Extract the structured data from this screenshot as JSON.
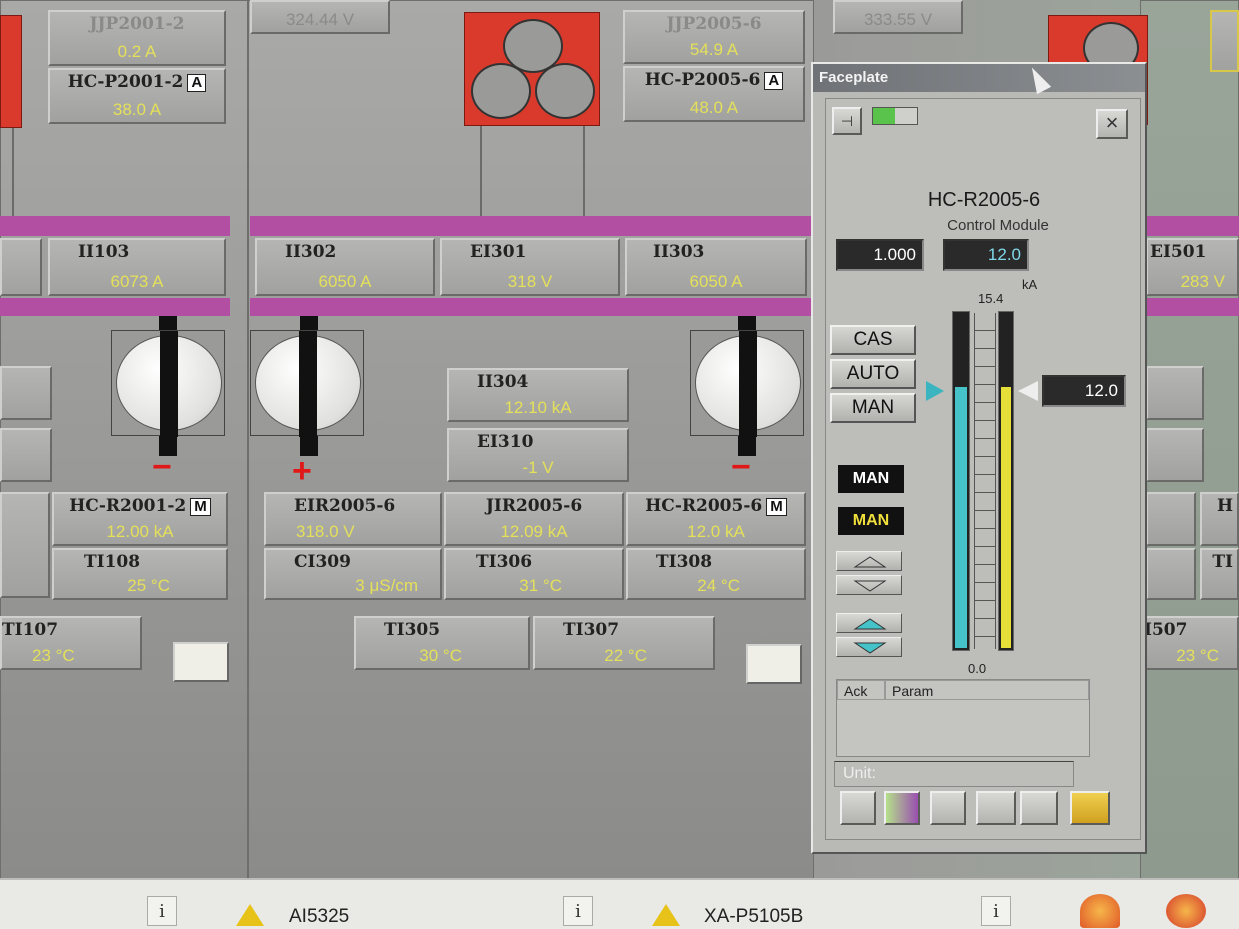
{
  "colors": {
    "value_text": "#e4e05a",
    "bus": "#b24fa3",
    "motor": "#d93a2c",
    "sign": "#e01818"
  },
  "top_values": {
    "left_top": "JJP2001-2",
    "left_top_val": "0.2 A",
    "left_mid": "HC-P2001-2",
    "left_mid_val": "38.0 A",
    "left_badge": "A",
    "center_hidden": "324.44 V",
    "right_top": "JJP2005-6",
    "right_top_val": "54.9 A",
    "right_mid": "HC-P2005-6",
    "right_mid_val": "48.0 A",
    "right_badge": "A",
    "far_hidden": "333.55 V"
  },
  "bus_tags": [
    {
      "name": "II103",
      "value": "6073 A"
    },
    {
      "name": "II302",
      "value": "6050 A"
    },
    {
      "name": "EI301",
      "value": "318 V"
    },
    {
      "name": "II303",
      "value": "6050 A"
    },
    {
      "name": "EI501",
      "value": "283 V"
    }
  ],
  "mid_tags": [
    {
      "name": "II304",
      "value": "12.10 kA"
    },
    {
      "name": "EI310",
      "value": "-1 V"
    }
  ],
  "row1": [
    {
      "name": "HC-R2001-2",
      "value": "12.00 kA",
      "badge": "M"
    },
    {
      "name": "EIR2005-6",
      "value": "318.0 V"
    },
    {
      "name": "JIR2005-6",
      "value": "12.09 kA"
    },
    {
      "name": "HC-R2005-6",
      "value": "12.0 kA",
      "badge": "M"
    },
    {
      "name": "H",
      "value": ""
    }
  ],
  "row2": [
    {
      "name": "TI108",
      "value": "25 °C"
    },
    {
      "name": "CI309",
      "value": "3 μS/cm"
    },
    {
      "name": "TI306",
      "value": "31 °C"
    },
    {
      "name": "TI308",
      "value": "24 °C"
    },
    {
      "name": "TI",
      "value": ""
    }
  ],
  "row3": [
    {
      "name": "TI107",
      "value": "23 °C"
    },
    {
      "name": "TI305",
      "value": "30 °C"
    },
    {
      "name": "TI307",
      "value": "22 °C"
    },
    {
      "name": "I507",
      "value": "23 °C"
    }
  ],
  "signs": {
    "minus": "−",
    "plus": "+"
  },
  "faceplate": {
    "title": "Faceplate",
    "close": "×",
    "tag": "HC-R2005-6",
    "subtitle": "Control Module",
    "gain": "1.000",
    "pv": "12.0",
    "unit": "kA",
    "scale_max": "15.4",
    "scale_min": "0.0",
    "pv_fraction": 0.78,
    "sp_fraction": 0.78,
    "setpoint": "12.0",
    "modes": [
      "CAS",
      "AUTO",
      "MAN"
    ],
    "mode_tag1": "MAN",
    "mode_tag2": "MAN",
    "alarm_cols": [
      "Ack",
      "Param"
    ],
    "unit_label": "Unit:"
  },
  "statusbar": {
    "info": "i",
    "alarm1": "AI5325",
    "alarm2": "XA-P5105B"
  }
}
